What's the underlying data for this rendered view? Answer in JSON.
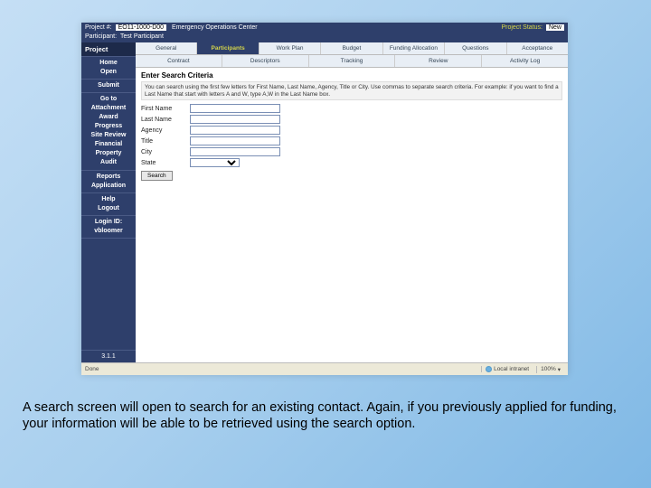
{
  "header": {
    "project_num_label": "Project #:",
    "project_num_value": "EO11-1000-D00",
    "project_desc": "Emergency Operations Center",
    "status_label": "Project Status:",
    "status_value": "New",
    "participant_label": "Participant:",
    "participant_value": "Test Participant"
  },
  "sidebar": {
    "heading": "Project",
    "nav1": [
      "Home",
      "Open"
    ],
    "nav2": [
      "Submit"
    ],
    "nav3": [
      "Go to",
      "Attachment",
      "Award",
      "Progress",
      "Site Review",
      "Financial",
      "Property",
      "Audit"
    ],
    "nav4": [
      "Reports",
      "Application"
    ],
    "nav5": [
      "Help",
      "Logout"
    ],
    "login_label": "Login ID:",
    "login_value": "vbloomer",
    "version": "3.1.1"
  },
  "tabs_row1": [
    "General",
    "Participants",
    "Work Plan",
    "Budget",
    "Funding Allocation",
    "Questions",
    "Acceptance"
  ],
  "tabs_row2": [
    "Contract",
    "Descriptors",
    "Tracking",
    "Review",
    "Activity Log"
  ],
  "active_tab": 1,
  "search": {
    "heading": "Enter Search Criteria",
    "help": "You can search using the first few letters for First Name, Last Name, Agency, Title or City. Use commas to separate search criteria. For example:   if you want to find a Last Name that start with letters A and W, type A,W in the Last Name box.",
    "fields": [
      {
        "label": "First Name",
        "type": "text",
        "value": ""
      },
      {
        "label": "Last Name",
        "type": "text",
        "value": ""
      },
      {
        "label": "Agency",
        "type": "text",
        "value": ""
      },
      {
        "label": "Title",
        "type": "text",
        "value": ""
      },
      {
        "label": "City",
        "type": "text",
        "value": ""
      },
      {
        "label": "State",
        "type": "select",
        "value": ""
      }
    ],
    "button": "Search"
  },
  "statusbar": {
    "left": "Done",
    "zone": "Local intranet",
    "zoom": "100%"
  },
  "caption": "A search screen will open to search for an existing contact.  Again, if you previously applied for funding, your information will be able to be retrieved using the search option."
}
